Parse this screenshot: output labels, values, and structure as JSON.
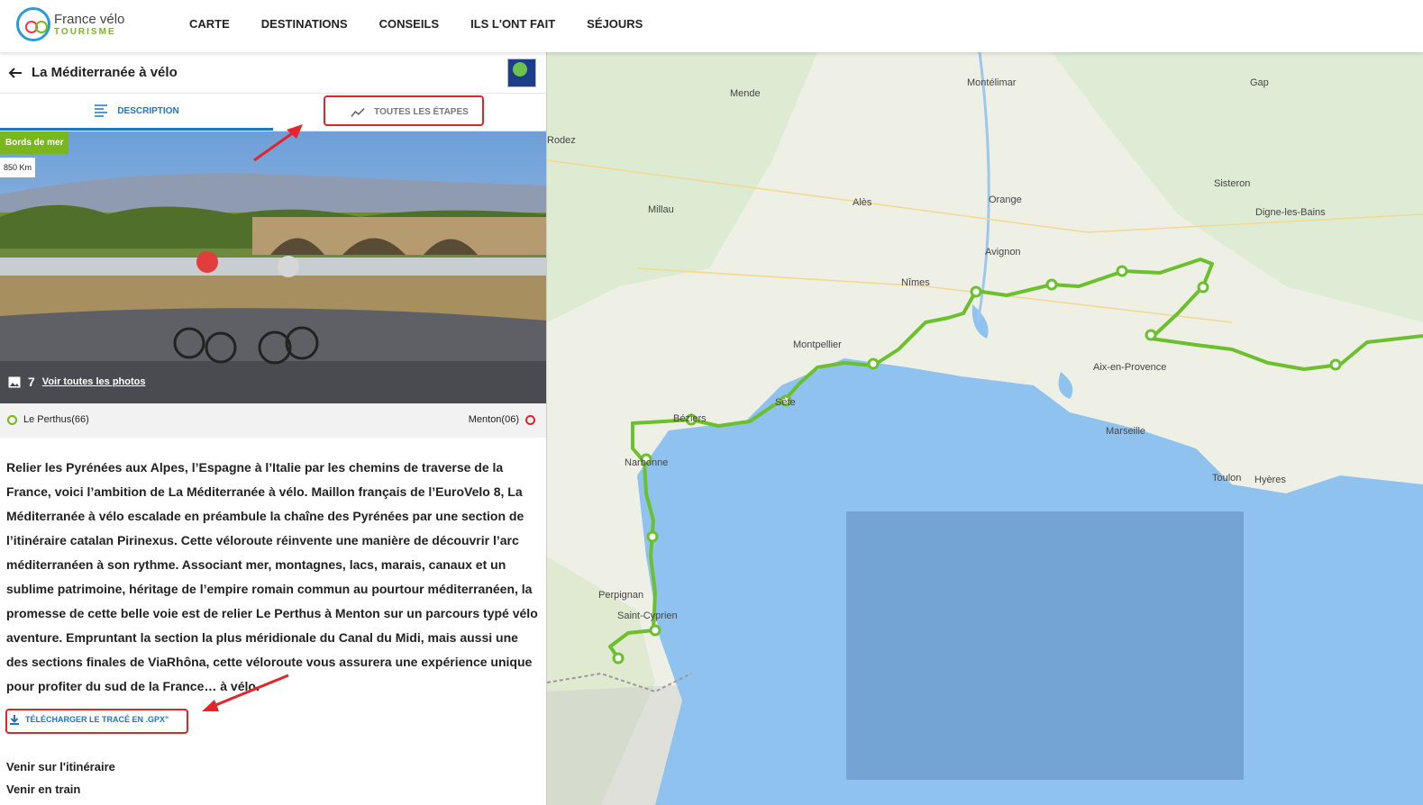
{
  "header": {
    "logo": {
      "main": "France vélo",
      "sub": "TOURISME"
    },
    "nav": [
      "CARTE",
      "DESTINATIONS",
      "CONSEILS",
      "ILS L'ONT FAIT",
      "SÉJOURS"
    ]
  },
  "route": {
    "title": "La Méditerranée à vélo",
    "tabs": {
      "description": "DESCRIPTION",
      "stages": "TOUTES LES ÉTAPES"
    },
    "badge": "Bords de mer",
    "distance": "850 Km",
    "photos": {
      "count": "7",
      "link": "Voir toutes les photos"
    },
    "start": "Le Perthus(66)",
    "end": "Menton(06)",
    "description": "Relier les Pyrénées aux Alpes, l’Espagne à l’Italie par les chemins de traverse de la France, voici l’ambition de La Méditerranée à vélo. Maillon français de l’EuroVelo 8, La Méditerranée à vélo escalade en préambule la chaîne des Pyrénées par une section de l’itinéraire catalan Pirinexus. Cette véloroute réinvente une manière de découvrir l’arc méditerranéen à son rythme. Associant mer, montagnes, lacs, marais, canaux et un sublime patrimoine, héritage de l’empire romain commun au pourtour méditerranéen, la promesse de cette belle voie est de relier Le Perthus à Menton sur un parcours typé vélo aventure. Empruntant la section la plus méridionale du Canal du Midi, mais aussi une des sections finales de ViaRhôna, cette véloroute vous assurera une expérience unique pour profiter du sud de la France… à vélo.",
    "gpx": "TÉLÉCHARGER LE TRACÉ EN .GPX\"",
    "links": [
      "Venir sur l'itinéraire",
      "Venir en train"
    ]
  },
  "map": {
    "cities": [
      "Mende",
      "Montélimar",
      "Gap",
      "Rodez",
      "Millau",
      "Alès",
      "Orange",
      "Sisteron",
      "Digne-les-Bains",
      "Avignon",
      "Nîmes",
      "Montpellier",
      "Aix-en-Provence",
      "Sète",
      "Béziers",
      "Marseille",
      "Narbonne",
      "Toulon",
      "Hyères",
      "Perpignan",
      "Saint-Cyprien"
    ]
  },
  "colors": {
    "accent": "#2076c4",
    "green": "#7ab61e",
    "red": "#e3242b",
    "sea": "#8fc2ee"
  }
}
